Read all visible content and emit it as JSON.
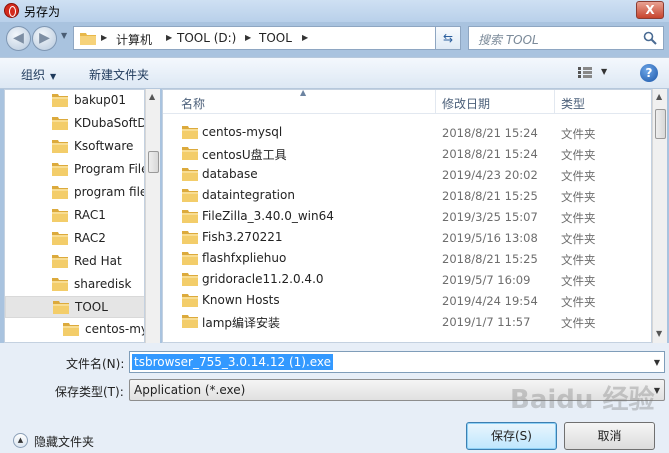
{
  "window": {
    "title": "另存为",
    "close_label": "X"
  },
  "nav": {
    "breadcrumbs": [
      "计算机",
      "TOOL (D:)",
      "TOOL"
    ],
    "search_placeholder": "搜索 TOOL"
  },
  "toolbar": {
    "organize": "组织",
    "new_folder": "新建文件夹",
    "help": "?"
  },
  "sidebar": {
    "items": [
      {
        "label": "bakup01"
      },
      {
        "label": "KDubaSoftD"
      },
      {
        "label": "Ksoftware"
      },
      {
        "label": "Program File"
      },
      {
        "label": "program file"
      },
      {
        "label": "RAC1"
      },
      {
        "label": "RAC2"
      },
      {
        "label": "Red Hat"
      },
      {
        "label": "sharedisk"
      },
      {
        "label": "TOOL",
        "selected": true
      },
      {
        "label": "centos-my",
        "child": true
      }
    ]
  },
  "filelist": {
    "columns": {
      "name": "名称",
      "date": "修改日期",
      "type": "类型"
    },
    "rows": [
      {
        "name": "centos-mysql",
        "date": "2018/8/21 15:24",
        "type": "文件夹"
      },
      {
        "name": "centosU盘工具",
        "date": "2018/8/21 15:24",
        "type": "文件夹"
      },
      {
        "name": "database",
        "date": "2019/4/23 20:02",
        "type": "文件夹"
      },
      {
        "name": "dataintegration",
        "date": "2018/8/21 15:25",
        "type": "文件夹"
      },
      {
        "name": "FileZilla_3.40.0_win64",
        "date": "2019/3/25 15:07",
        "type": "文件夹"
      },
      {
        "name": "Fish3.270221",
        "date": "2019/5/16 13:08",
        "type": "文件夹"
      },
      {
        "name": "flashfxpliehuo",
        "date": "2018/8/21 15:25",
        "type": "文件夹"
      },
      {
        "name": "gridoracle11.2.0.4.0",
        "date": "2019/5/7 16:09",
        "type": "文件夹"
      },
      {
        "name": "Known Hosts",
        "date": "2019/4/24 19:54",
        "type": "文件夹"
      },
      {
        "name": "lamp编译安装",
        "date": "2019/1/7 11:57",
        "type": "文件夹"
      }
    ]
  },
  "form": {
    "filename_label": "文件名(N):",
    "filename_value": "tsbrowser_755_3.0.14.12 (1).exe",
    "filetype_label": "保存类型(T):",
    "filetype_value": "Application (*.exe)",
    "hide_folders": "隐藏文件夹",
    "save": "保存(S)",
    "cancel": "取消"
  },
  "watermark": "Baidu 经验"
}
